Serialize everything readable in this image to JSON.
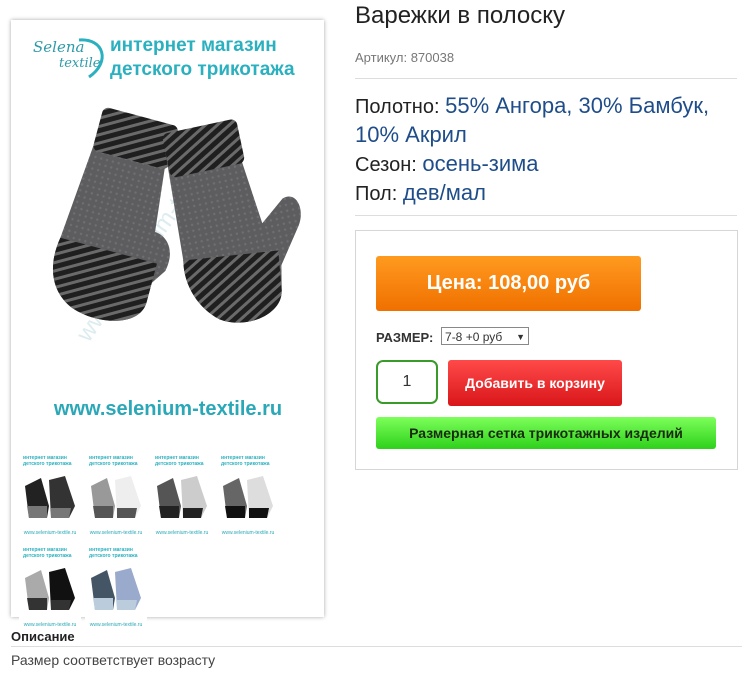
{
  "product": {
    "title": "Варежки в полоску",
    "sku_label": "Артикул:",
    "sku": "870038"
  },
  "properties": [
    {
      "label": "Полотно:",
      "value": "55% Ангора, 30% Бамбук, 10% Акрил"
    },
    {
      "label": "Сезон:",
      "value": "осень-зима"
    },
    {
      "label": "Пол:",
      "value": "дев/мал"
    }
  ],
  "image": {
    "brand_line1": "Selena",
    "brand_line2": "textile",
    "tagline_line1": "интернет магазин",
    "tagline_line2": "детского трикотажа",
    "site_url": "www.selenium-textile.ru",
    "watermark": "www.selenium-textile.ru",
    "thumb_head_line1": "интернет магазин",
    "thumb_head_line2": "детского трикотажа",
    "thumb_url": "www.selenium-textile.ru"
  },
  "buy": {
    "price_label": "Цена: 108,00 руб",
    "size_label": "РАЗМЕР:",
    "size_value": "7-8 +0 руб",
    "quantity": "1",
    "add_to_cart": "Добавить в корзину",
    "size_chart": "Размерная сетка трикотажных изделий"
  },
  "description": {
    "heading": "Описание",
    "text": "Размер соответствует возрасту"
  },
  "colors": {
    "price": "#f58300",
    "cart": "#e8262a",
    "chart": "#4fe33a",
    "brand": "#2ab0bf",
    "value_text": "#1e4d8a"
  },
  "thumbnails": [
    {
      "cuff": "#222",
      "body": "#333",
      "stripe": "#777"
    },
    {
      "cuff": "#eee",
      "body": "#999",
      "stripe": "#555"
    },
    {
      "cuff": "#ccc",
      "body": "#555",
      "stripe": "#222"
    },
    {
      "cuff": "#ddd",
      "body": "#666",
      "stripe": "#111"
    },
    {
      "cuff": "#111",
      "body": "#aaa",
      "stripe": "#333"
    },
    {
      "cuff": "#9ac",
      "body": "#456",
      "stripe": "#bcd"
    }
  ]
}
